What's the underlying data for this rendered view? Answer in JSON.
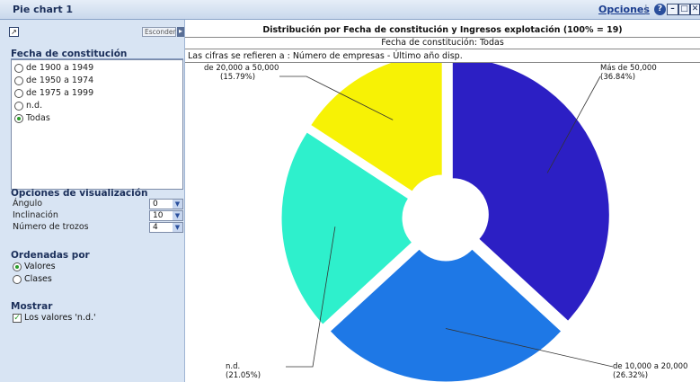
{
  "window": {
    "title": "Pie chart 1",
    "options_link": "Opciones",
    "separator": "|"
  },
  "sidebar": {
    "hide_button": "Esconder",
    "fecha_title": "Fecha de constitución",
    "fecha_options": [
      {
        "label": "de 1900 a 1949",
        "selected": false
      },
      {
        "label": "de 1950 a 1974",
        "selected": false
      },
      {
        "label": "de 1975 a 1999",
        "selected": false
      },
      {
        "label": "n.d.",
        "selected": false
      },
      {
        "label": "Todas",
        "selected": true
      }
    ],
    "vis_title": "Opciones de visualización",
    "vis_options": [
      {
        "label": "Ángulo",
        "value": "0"
      },
      {
        "label": "Inclinación",
        "value": "10"
      },
      {
        "label": "Número de trozos",
        "value": "4"
      }
    ],
    "order_title": "Ordenadas por",
    "order_options": [
      {
        "label": "Valores",
        "selected": true
      },
      {
        "label": "Clases",
        "selected": false
      }
    ],
    "show_title": "Mostrar",
    "show_nd_label": "Los valores 'n.d.'",
    "show_nd_checked": true
  },
  "chart_data": {
    "type": "pie",
    "donut": true,
    "title": "Distribución por Fecha de constitución y Ingresos explotación (100% = 19)",
    "subtitle": "Fecha de constitución: Todas",
    "note": "Las cifras se refieren a : Número de empresas - Último año disp.",
    "slices": [
      {
        "label": "Más de 50,000",
        "percent": 36.84,
        "percent_text": "(36.84%)",
        "color": "#2c1fc4"
      },
      {
        "label": "de 10,000 a 20,000",
        "percent": 26.32,
        "percent_text": "(26.32%)",
        "color": "#1e78e6"
      },
      {
        "label": "n.d.",
        "percent": 21.05,
        "percent_text": "(21.05%)",
        "color": "#2ef0cc"
      },
      {
        "label": "de 20,000 a 50,000",
        "percent": 15.79,
        "percent_text": "(15.79%)",
        "color": "#f7f205"
      }
    ]
  }
}
